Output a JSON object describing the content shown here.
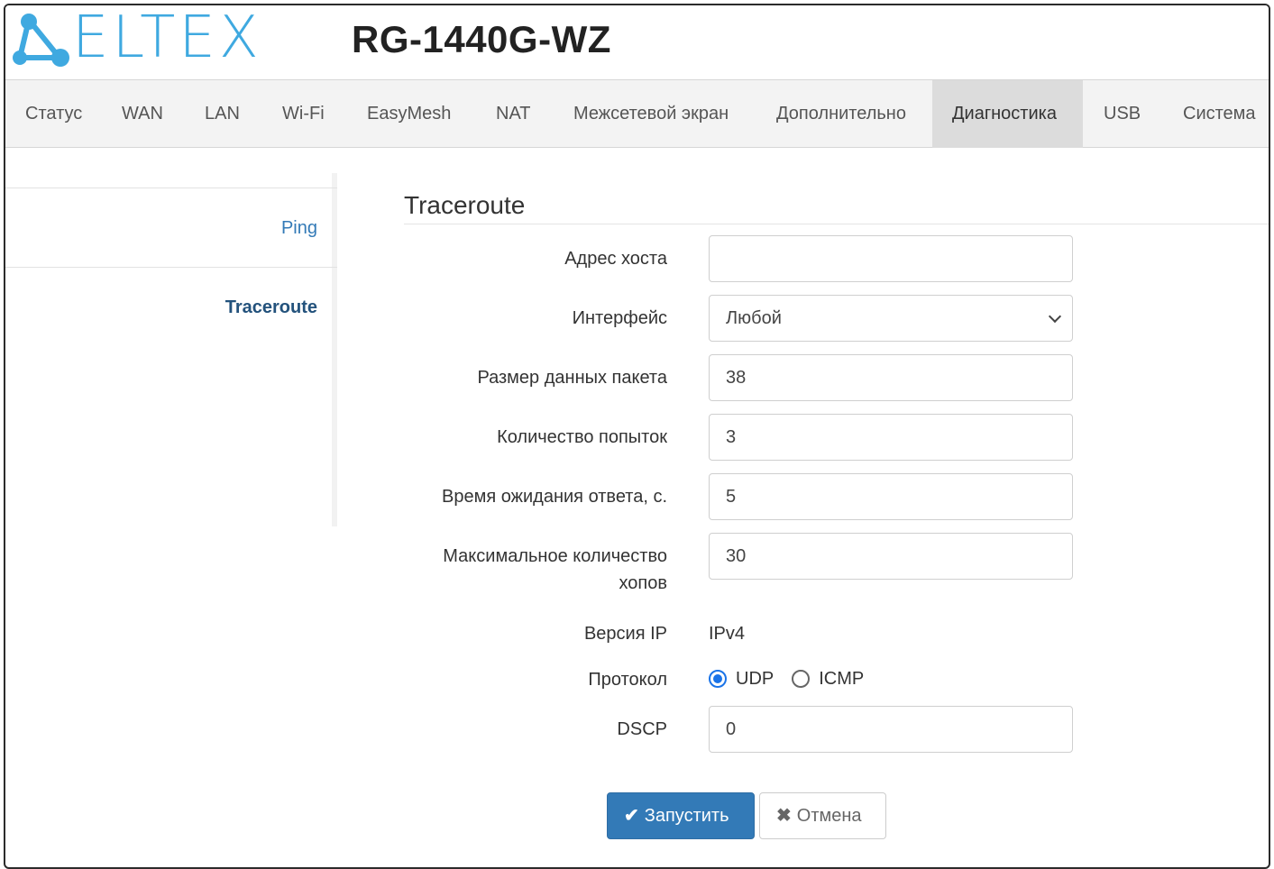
{
  "header": {
    "logo_text": "ELTEX",
    "model": "RG-1440G-WZ"
  },
  "nav": {
    "items": [
      {
        "label": "Статус"
      },
      {
        "label": "WAN"
      },
      {
        "label": "LAN"
      },
      {
        "label": "Wi-Fi"
      },
      {
        "label": "EasyMesh"
      },
      {
        "label": "NAT"
      },
      {
        "label": "Межсетевой экран"
      },
      {
        "label": "Дополнительно"
      },
      {
        "label": "Диагностика",
        "active": true
      },
      {
        "label": "USB"
      },
      {
        "label": "Система"
      }
    ]
  },
  "sidebar": {
    "items": [
      {
        "label": "Ping"
      },
      {
        "label": "Traceroute",
        "active": true
      }
    ]
  },
  "form": {
    "title": "Traceroute",
    "host": {
      "label": "Адрес хоста",
      "value": ""
    },
    "interface": {
      "label": "Интерфейс",
      "value": "Любой"
    },
    "packet_size": {
      "label": "Размер данных пакета",
      "value": "38"
    },
    "attempts": {
      "label": "Количество попыток",
      "value": "3"
    },
    "timeout": {
      "label": "Время ожидания ответа, с.",
      "value": "5"
    },
    "max_hops": {
      "label_line1": "Максимальное количество",
      "label_line2": "хопов",
      "value": "30"
    },
    "ip_version": {
      "label": "Версия IP",
      "value": "IPv4"
    },
    "protocol": {
      "label": "Протокол",
      "options": [
        "UDP",
        "ICMP"
      ],
      "selected": "UDP"
    },
    "dscp": {
      "label": "DSCP",
      "value": "0"
    }
  },
  "buttons": {
    "run_label": "Запустить",
    "cancel_label": "Отмена"
  },
  "colors": {
    "brand": "#3fa9e0",
    "primary": "#337ab7",
    "link": "#337ab7"
  }
}
